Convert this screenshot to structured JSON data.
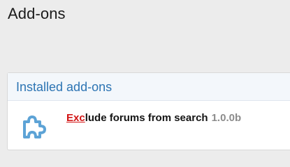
{
  "page": {
    "title": "Add-ons"
  },
  "installed": {
    "heading": "Installed add-ons",
    "items": [
      {
        "title_highlight": "Exc",
        "title_rest": "lude forums from search",
        "version": "1.0.0b",
        "icon": "puzzle-icon"
      }
    ]
  },
  "colors": {
    "heading": "#2c74b3",
    "highlight": "#d21414",
    "icon": "#5da3d6",
    "version": "#8c8c8c"
  }
}
